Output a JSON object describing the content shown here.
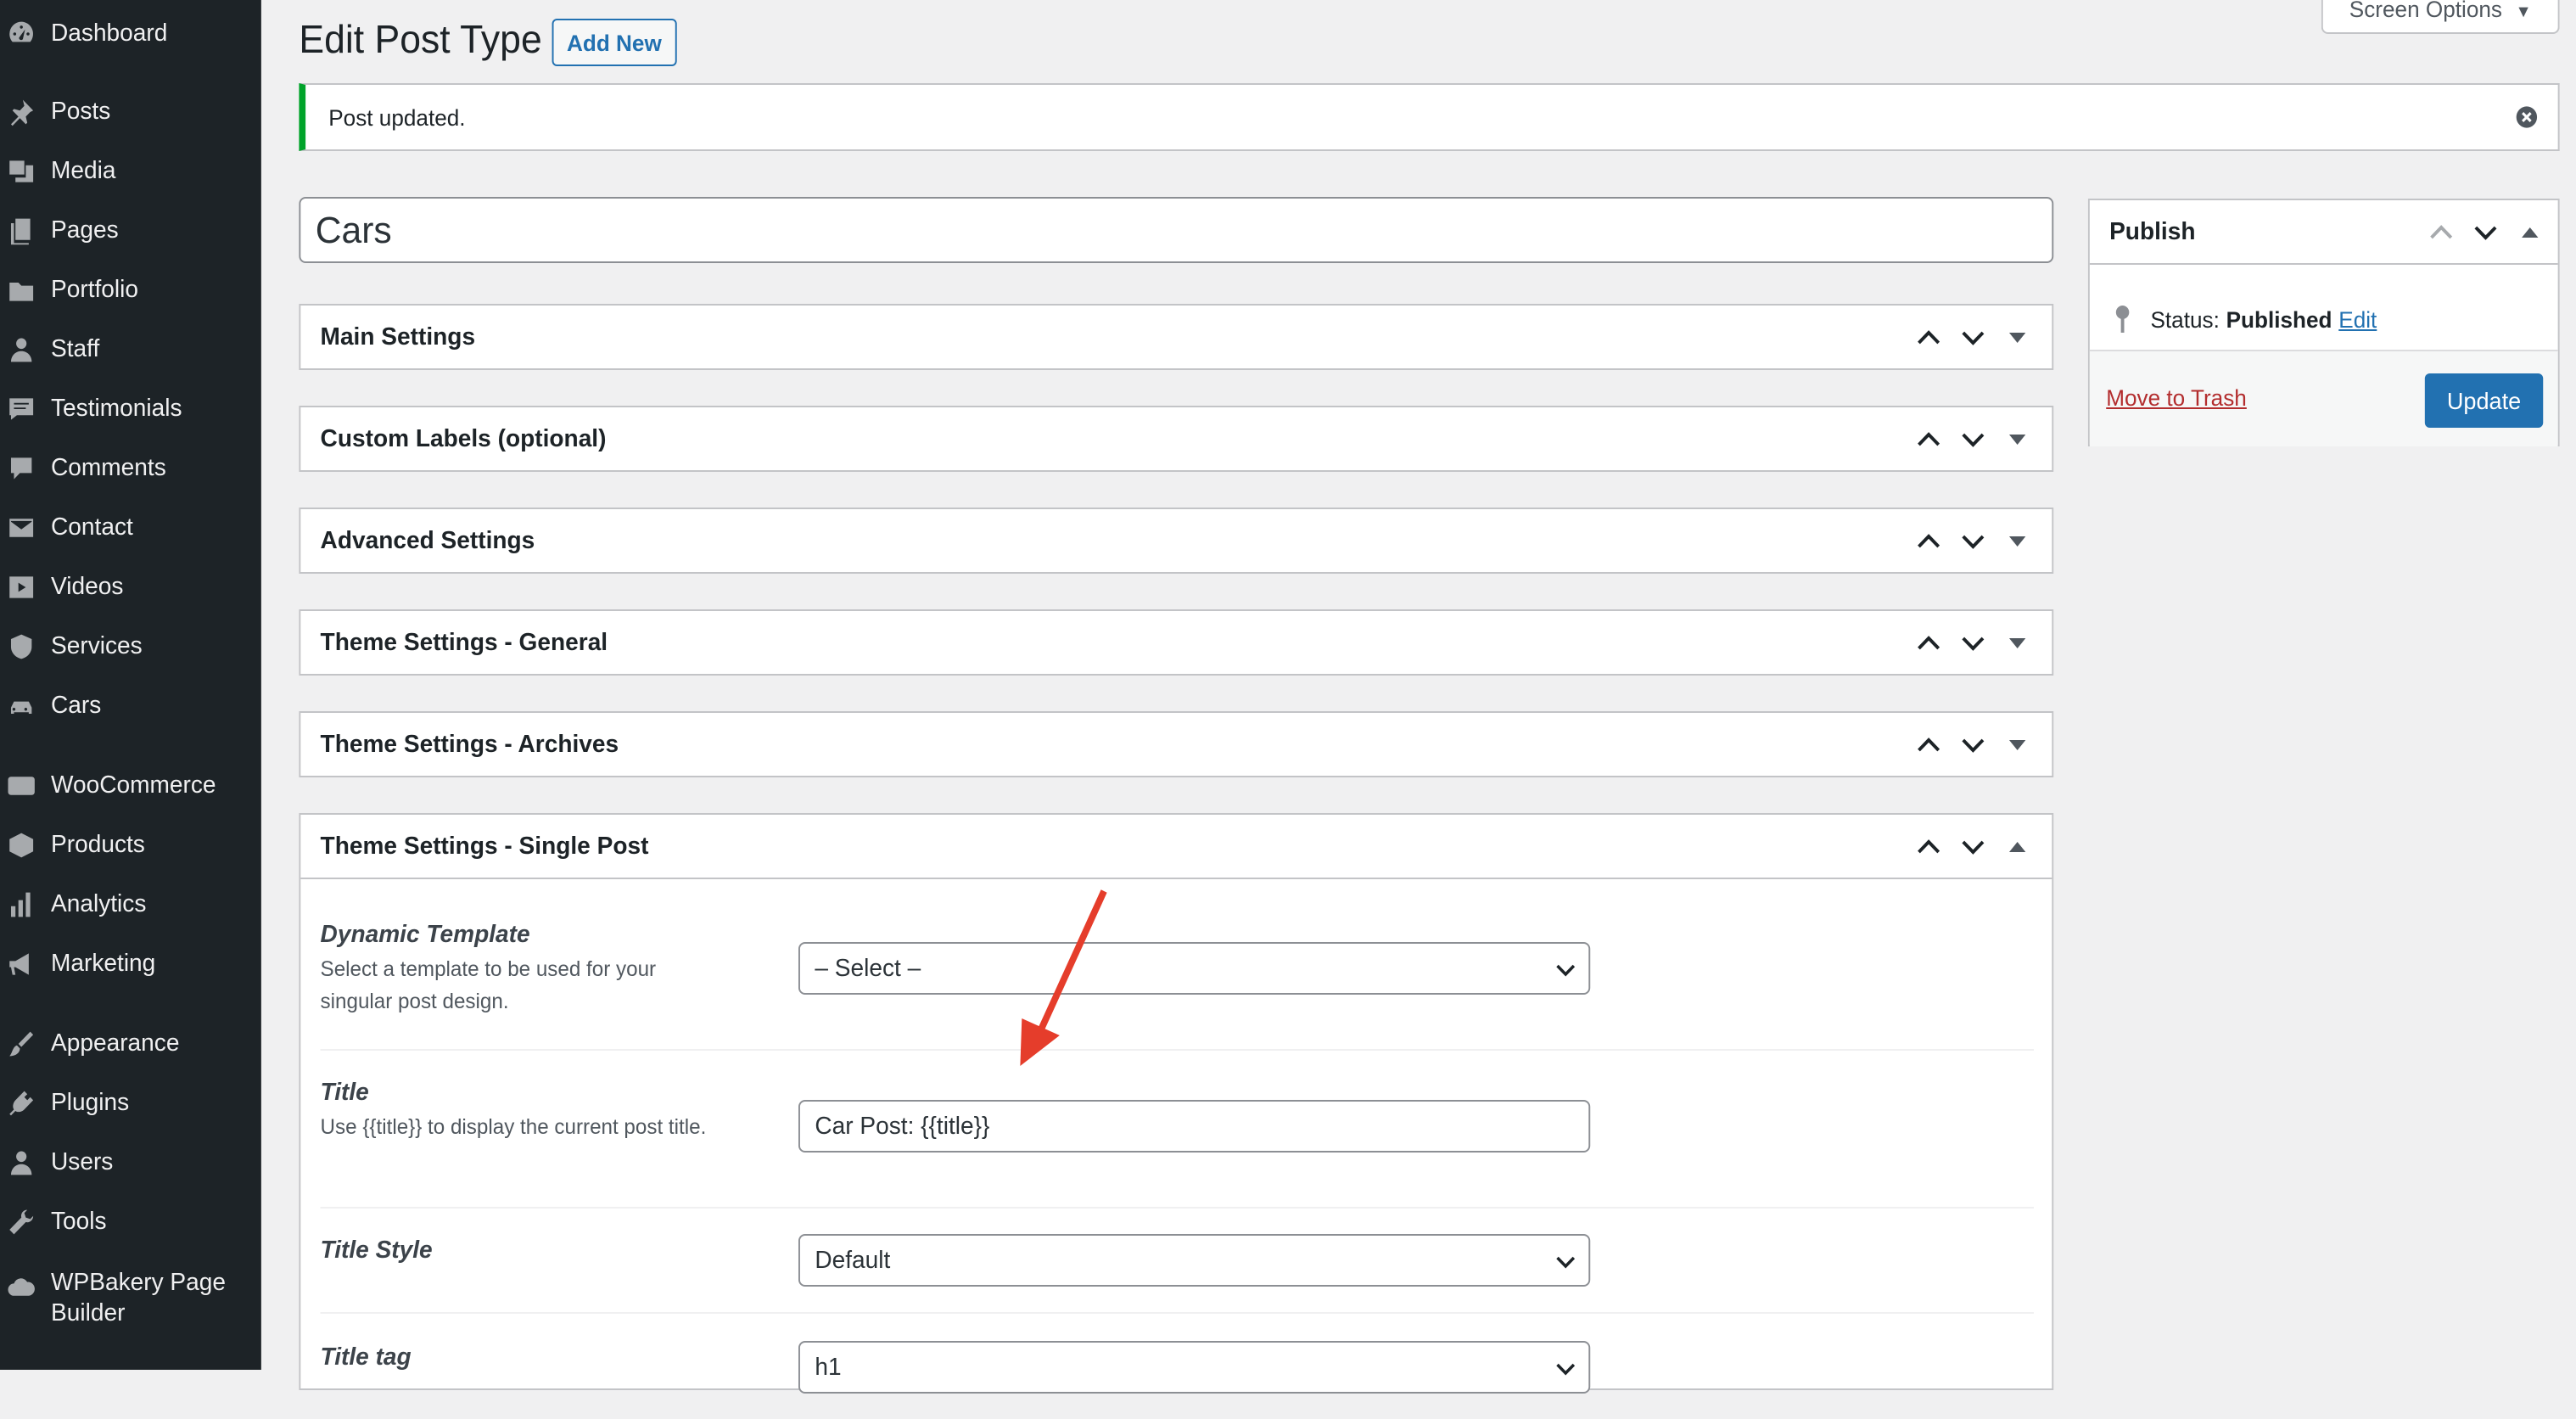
{
  "sidebar": {
    "items": [
      {
        "label": "Dashboard",
        "icon": "dashboard-icon"
      },
      {
        "label": "Posts",
        "icon": "pushpin-icon"
      },
      {
        "label": "Media",
        "icon": "media-icon"
      },
      {
        "label": "Pages",
        "icon": "pages-icon"
      },
      {
        "label": "Portfolio",
        "icon": "portfolio-icon"
      },
      {
        "label": "Staff",
        "icon": "staff-icon"
      },
      {
        "label": "Testimonials",
        "icon": "testimonials-icon"
      },
      {
        "label": "Comments",
        "icon": "comments-icon"
      },
      {
        "label": "Contact",
        "icon": "envelope-icon"
      },
      {
        "label": "Videos",
        "icon": "video-icon"
      },
      {
        "label": "Services",
        "icon": "services-icon"
      },
      {
        "label": "Cars",
        "icon": "car-icon"
      },
      {
        "label": "WooCommerce",
        "icon": "woocommerce-icon"
      },
      {
        "label": "Products",
        "icon": "products-icon"
      },
      {
        "label": "Analytics",
        "icon": "analytics-icon"
      },
      {
        "label": "Marketing",
        "icon": "megaphone-icon"
      },
      {
        "label": "Appearance",
        "icon": "paintbrush-icon"
      },
      {
        "label": "Plugins",
        "icon": "plugin-icon"
      },
      {
        "label": "Users",
        "icon": "users-icon"
      },
      {
        "label": "Tools",
        "icon": "wrench-icon"
      },
      {
        "label": "WPBakery Page Builder",
        "icon": "cloud-icon"
      }
    ]
  },
  "header": {
    "title": "Edit Post Type",
    "add_new": "Add New",
    "screen_options": "Screen Options"
  },
  "notice": {
    "message": "Post updated."
  },
  "post": {
    "title": "Cars"
  },
  "metaboxes": [
    {
      "title": "Main Settings"
    },
    {
      "title": "Custom Labels (optional)"
    },
    {
      "title": "Advanced Settings"
    },
    {
      "title": "Theme Settings - General"
    },
    {
      "title": "Theme Settings - Archives"
    },
    {
      "title": "Theme Settings - Single Post"
    }
  ],
  "single_post": {
    "fields": [
      {
        "label": "Dynamic Template",
        "desc": "Select a template to be used for your singular post design.",
        "value": "– Select –"
      },
      {
        "label": "Title",
        "desc": "Use {{title}} to display the current post title.",
        "value": "Car Post: {{title}}"
      },
      {
        "label": "Title Style",
        "desc": "",
        "value": "Default"
      },
      {
        "label": "Title tag",
        "desc": "",
        "value": "h1"
      }
    ]
  },
  "publish": {
    "title": "Publish",
    "status_label": "Status:",
    "status_value": "Published",
    "edit": "Edit",
    "trash": "Move to Trash",
    "update": "Update"
  },
  "colors": {
    "sidebar_bg": "#1d2327",
    "accent": "#2271b1",
    "success": "#00a32a",
    "danger": "#b32d2e",
    "annotation_arrow": "#e53d2b"
  }
}
